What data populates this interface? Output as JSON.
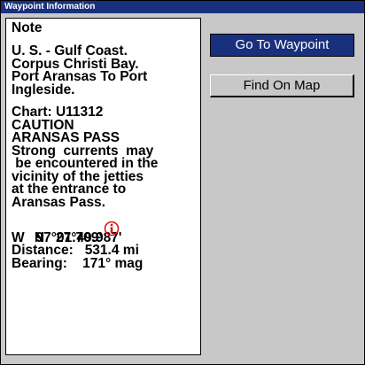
{
  "window": {
    "title": "Waypoint Information"
  },
  "note": {
    "heading": "Note",
    "location_lines": [
      "U. S. - Gulf Coast.",
      "Corpus Christi Bay.",
      "Port Aransas To Port",
      "Ingleside."
    ],
    "chart_lines": [
      "Chart: U11312",
      "CAUTION",
      "ARANSAS PASS",
      "Strong  currents  may",
      " be encountered in the",
      "vicinity of the jetties",
      "at the entrance to",
      "Aransas Pass."
    ],
    "latitude": "N   27°49.987'",
    "longitude": "W   97°01.709'",
    "distance": "Distance:   531.4 mi",
    "bearing": "Bearing:    171° mag"
  },
  "buttons": {
    "go_to_waypoint": "Go To Waypoint",
    "find_on_map": "Find On Map"
  },
  "icons": {
    "info": "info-icon"
  },
  "colors": {
    "title_bar": "#18307e",
    "panel_background": "#c8c8c8",
    "selected_button": "#18307e",
    "info_icon": "#d81818"
  }
}
